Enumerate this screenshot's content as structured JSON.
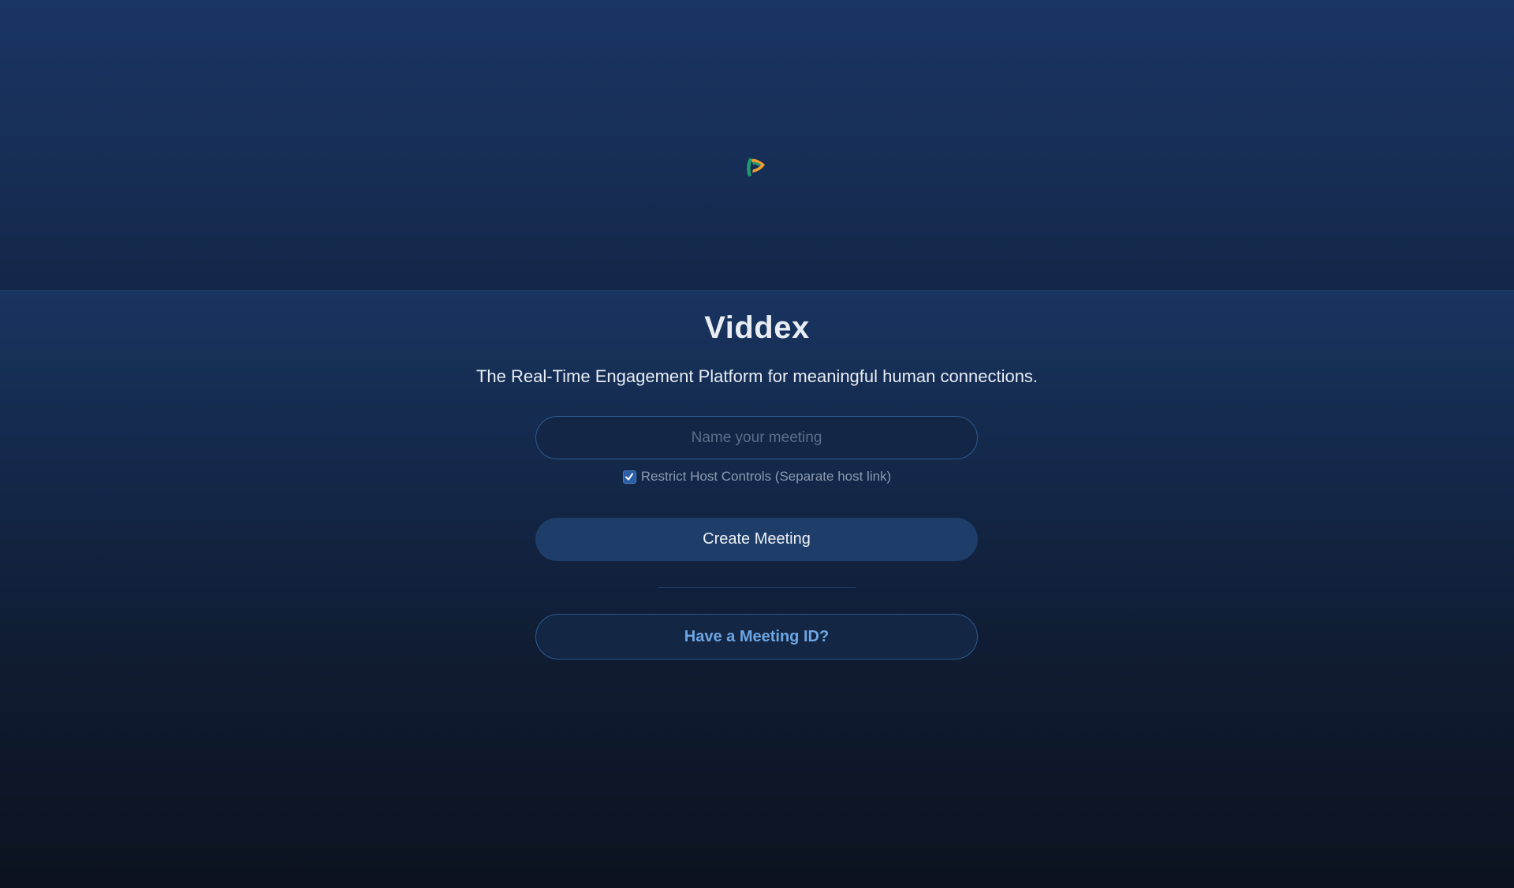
{
  "app": {
    "title": "Viddex",
    "tagline": "The Real-Time Engagement Platform for meaningful human connections.",
    "logo_icon": "viddex-logo-icon",
    "colors": {
      "background_top": "#1a3463",
      "background_bottom": "#0c1220",
      "accent": "#6ea6e3",
      "button_primary": "#1e3d68",
      "logo_green": "#1f9a6e",
      "logo_orange": "#f0a030"
    }
  },
  "form": {
    "meeting_name": {
      "value": "",
      "placeholder": "Name your meeting"
    },
    "restrict_host": {
      "checked": true,
      "label": "Restrict Host Controls (Separate host link)"
    },
    "create_label": "Create Meeting",
    "join_label": "Have a Meeting ID?"
  }
}
